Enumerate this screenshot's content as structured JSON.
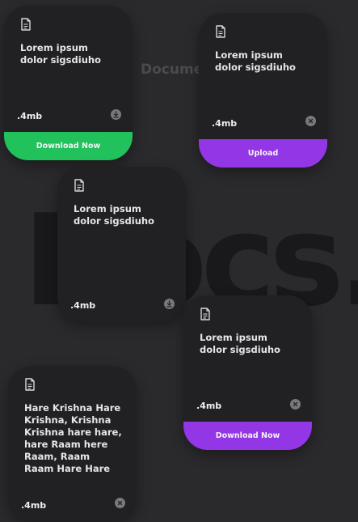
{
  "page": {
    "heading": "Documents",
    "background_title": "Docs."
  },
  "colors": {
    "background": "#2a292c",
    "card": "#212023",
    "green": "#21c15c",
    "purple": "#9336e6"
  },
  "cards": [
    {
      "description": "Lorem ipsum dolor sigsdiuho",
      "size": ".4mb",
      "icon": "download-icon",
      "button": "Download Now",
      "button_color": "green"
    },
    {
      "description": "Lorem ipsum dolor sigsdiuho",
      "size": ".4mb",
      "icon": "close-icon",
      "button": "Upload",
      "button_color": "purple"
    },
    {
      "description": "Lorem ipsum dolor sigsdiuho",
      "size": ".4mb",
      "icon": "download-icon",
      "button": null
    },
    {
      "description": "Lorem ipsum dolor sigsdiuho",
      "size": ".4mb",
      "icon": "close-icon",
      "button": "Download Now",
      "button_color": "purple"
    },
    {
      "description": "Hare Krishna Hare Krishna, Krishna Krishna hare hare, hare Raam here Raam, Raam Raam Hare Hare",
      "size": ".4mb",
      "icon": "close-icon",
      "button": null
    }
  ]
}
